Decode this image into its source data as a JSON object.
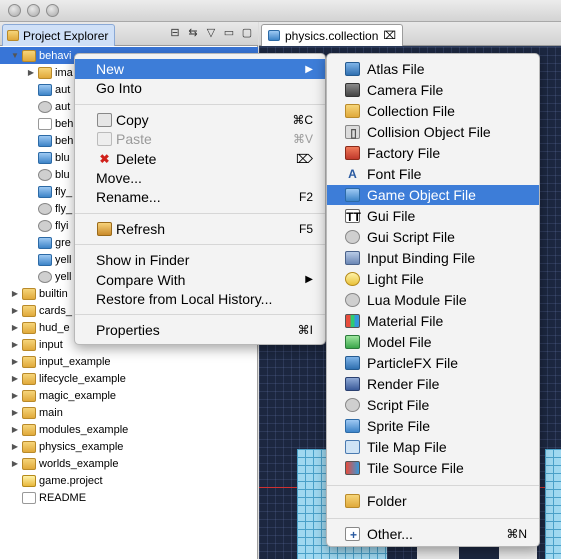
{
  "left_pane": {
    "tab_label": "Project Explorer",
    "tree": [
      {
        "label": "behavi",
        "level": 0,
        "type": "folder",
        "selected": true,
        "expanded": true
      },
      {
        "label": "ima",
        "level": 1,
        "type": "folder"
      },
      {
        "label": "aut",
        "level": 1,
        "type": "cube"
      },
      {
        "label": "aut",
        "level": 1,
        "type": "gear"
      },
      {
        "label": "beh",
        "level": 1,
        "type": "doc"
      },
      {
        "label": "beh",
        "level": 1,
        "type": "cube"
      },
      {
        "label": "blu",
        "level": 1,
        "type": "cube"
      },
      {
        "label": "blu",
        "level": 1,
        "type": "gear"
      },
      {
        "label": "fly_",
        "level": 1,
        "type": "cube"
      },
      {
        "label": "fly_",
        "level": 1,
        "type": "gear"
      },
      {
        "label": "flyi",
        "level": 1,
        "type": "gear"
      },
      {
        "label": "gre",
        "level": 1,
        "type": "cube"
      },
      {
        "label": "yell",
        "level": 1,
        "type": "cube"
      },
      {
        "label": "yell",
        "level": 1,
        "type": "gear"
      },
      {
        "label": "builtin",
        "level": 0,
        "type": "folder"
      },
      {
        "label": "cards_",
        "level": 0,
        "type": "folder"
      },
      {
        "label": "hud_e",
        "level": 0,
        "type": "folder"
      },
      {
        "label": "input",
        "level": 0,
        "type": "folder"
      },
      {
        "label": "input_example",
        "level": 0,
        "type": "folder"
      },
      {
        "label": "lifecycle_example",
        "level": 0,
        "type": "folder"
      },
      {
        "label": "magic_example",
        "level": 0,
        "type": "folder"
      },
      {
        "label": "main",
        "level": 0,
        "type": "folder"
      },
      {
        "label": "modules_example",
        "level": 0,
        "type": "folder"
      },
      {
        "label": "physics_example",
        "level": 0,
        "type": "folder"
      },
      {
        "label": "worlds_example",
        "level": 0,
        "type": "folder"
      },
      {
        "label": "game.project",
        "level": 0,
        "type": "warn"
      },
      {
        "label": "README",
        "level": 0,
        "type": "doc"
      }
    ]
  },
  "editor": {
    "tab_label": "physics.collection",
    "close_glyph": "⌧"
  },
  "context_menu": {
    "items": [
      {
        "label": "New",
        "shortcut": "",
        "arrow": "▶",
        "highlight": true
      },
      {
        "label": "Go Into",
        "shortcut": ""
      },
      {
        "sep": true
      },
      {
        "label": "Copy",
        "shortcut": "⌘C",
        "icon": "copy"
      },
      {
        "label": "Paste",
        "shortcut": "⌘V",
        "icon": "paste",
        "disabled": true
      },
      {
        "label": "Delete",
        "shortcut": "⌦",
        "icon": "delete"
      },
      {
        "label": "Move...",
        "shortcut": ""
      },
      {
        "label": "Rename...",
        "shortcut": "F2"
      },
      {
        "sep": true
      },
      {
        "label": "Refresh",
        "shortcut": "F5",
        "icon": "refresh"
      },
      {
        "sep": true
      },
      {
        "label": "Show in Finder",
        "shortcut": ""
      },
      {
        "label": "Compare With",
        "shortcut": "",
        "arrow": "▶"
      },
      {
        "label": "Restore from Local History...",
        "shortcut": ""
      },
      {
        "sep": true
      },
      {
        "label": "Properties",
        "shortcut": "⌘I"
      }
    ]
  },
  "new_submenu": {
    "items": [
      {
        "label": "Atlas File",
        "icon": "atlas"
      },
      {
        "label": "Camera File",
        "icon": "camera"
      },
      {
        "label": "Collection File",
        "icon": "collection"
      },
      {
        "label": "Collision Object File",
        "icon": "collision"
      },
      {
        "label": "Factory File",
        "icon": "factory"
      },
      {
        "label": "Font File",
        "icon": "font"
      },
      {
        "label": "Game Object File",
        "icon": "gameobject",
        "highlight": true
      },
      {
        "label": "Gui File",
        "icon": "gui"
      },
      {
        "label": "Gui Script File",
        "icon": "gear"
      },
      {
        "label": "Input Binding File",
        "icon": "input"
      },
      {
        "label": "Light File",
        "icon": "light"
      },
      {
        "label": "Lua Module File",
        "icon": "gear"
      },
      {
        "label": "Material File",
        "icon": "material"
      },
      {
        "label": "Model File",
        "icon": "model"
      },
      {
        "label": "ParticleFX File",
        "icon": "particle"
      },
      {
        "label": "Render File",
        "icon": "render"
      },
      {
        "label": "Script File",
        "icon": "gear"
      },
      {
        "label": "Sprite File",
        "icon": "sprite"
      },
      {
        "label": "Tile Map File",
        "icon": "tilemap"
      },
      {
        "label": "Tile Source File",
        "icon": "tilesource"
      },
      {
        "sep": true
      },
      {
        "label": "Folder",
        "icon": "folder"
      },
      {
        "sep": true
      },
      {
        "label": "Other...",
        "icon": "other",
        "shortcut": "⌘N"
      }
    ]
  },
  "colors": {
    "highlight": "#3d7dd8",
    "selection": "#3875d7"
  }
}
